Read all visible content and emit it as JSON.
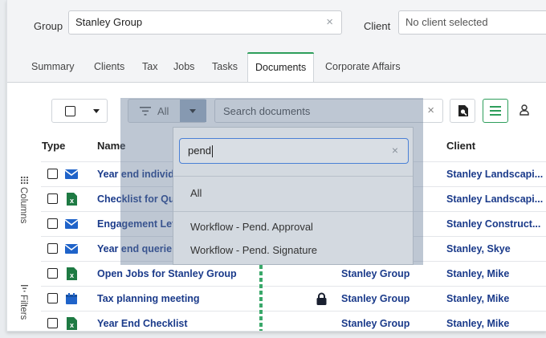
{
  "filters": {
    "group_label": "Group",
    "group_value": "Stanley Group",
    "client_label": "Client",
    "client_placeholder": "No client selected",
    "clear_glyph": "×"
  },
  "tabs": [
    {
      "label": "Summary"
    },
    {
      "label": "Clients"
    },
    {
      "label": "Tax"
    },
    {
      "label": "Jobs"
    },
    {
      "label": "Tasks"
    },
    {
      "label": "Documents",
      "active": true
    },
    {
      "label": "Corporate Affairs"
    }
  ],
  "toolbar": {
    "filter_value": "All",
    "search_placeholder": "Search documents",
    "clear_glyph": "×"
  },
  "side_panels": {
    "columns_label": "Columns",
    "filters_label": "Filters"
  },
  "table": {
    "headers": {
      "type": "Type",
      "name": "Name",
      "client": "Client"
    },
    "rows": [
      {
        "icon": "mail-icon",
        "name": "Year end individ",
        "group": "",
        "client": "Stanley Landscapi..."
      },
      {
        "icon": "excel-icon",
        "name": "Checklist for Qu",
        "group": "",
        "client": "Stanley Landscapi..."
      },
      {
        "icon": "mail-icon",
        "name": "Engagement Let",
        "group": "",
        "client": "Stanley Construct..."
      },
      {
        "icon": "mail-icon",
        "name": "Year end querie",
        "group": "",
        "client": "Stanley, Skye"
      },
      {
        "icon": "excel-icon",
        "name": "Open Jobs for Stanley Group",
        "group": "Stanley Group",
        "client": "Stanley, Mike"
      },
      {
        "icon": "calendar-icon",
        "name": "Tax planning meeting",
        "group": "Stanley Group",
        "client": "Stanley, Mike",
        "locked": true
      },
      {
        "icon": "excel-icon",
        "name": "Year End Checklist",
        "group": "Stanley Group",
        "client": "Stanley, Mike"
      }
    ]
  },
  "dropdown": {
    "search_value": "pend",
    "clear_glyph": "×",
    "options": [
      "All",
      "Workflow - Pend. Approval",
      "Workflow - Pend. Signature"
    ]
  },
  "colors": {
    "accent": "#2e9e5b",
    "link": "#1a3a8a",
    "mail_icon": "#1f63c9",
    "excel_icon": "#1e7a43"
  }
}
